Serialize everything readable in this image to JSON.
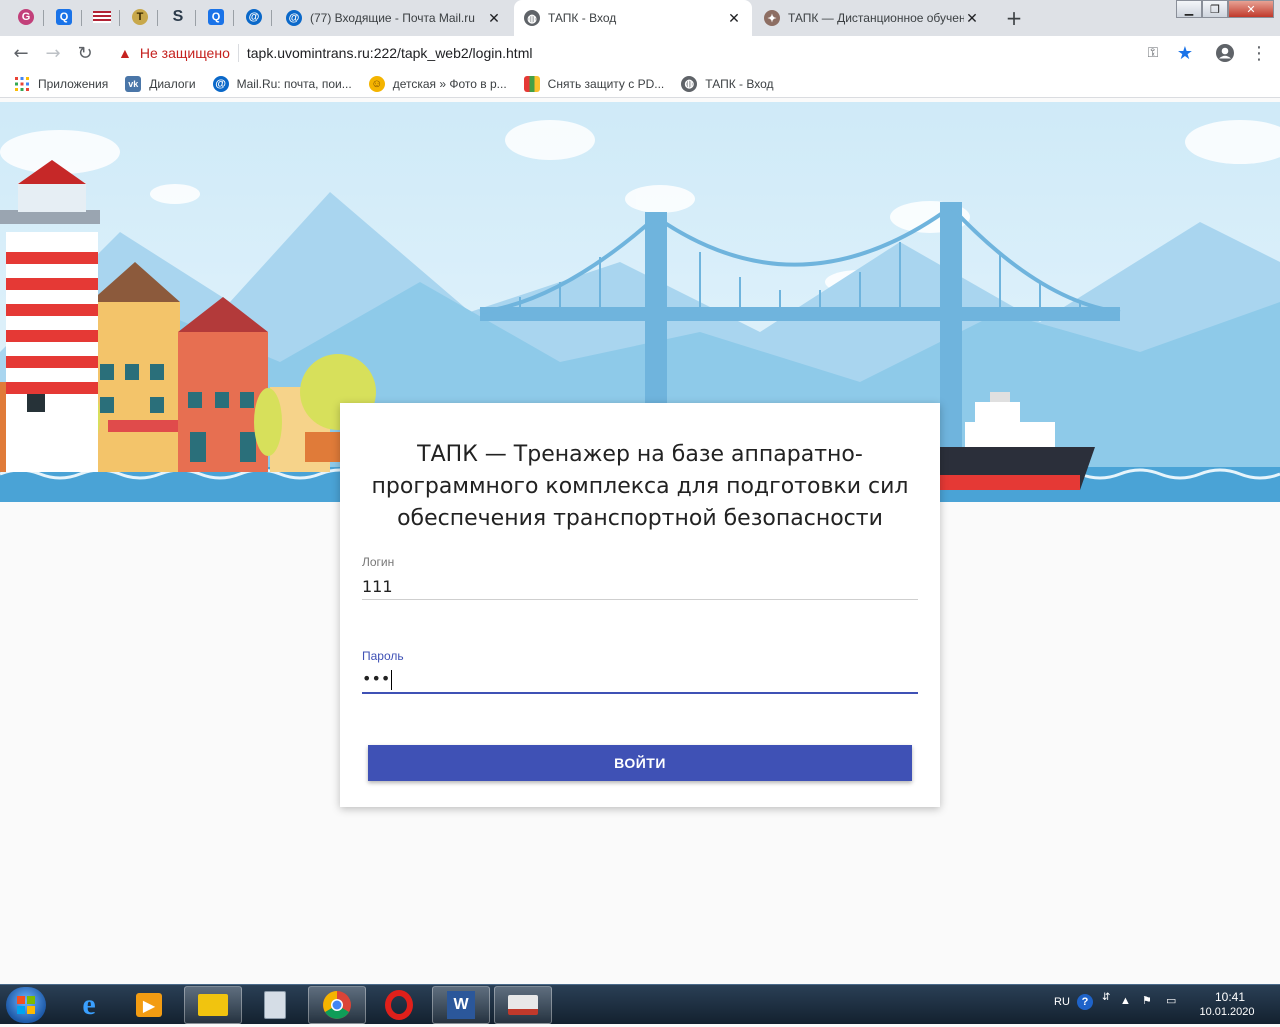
{
  "browser": {
    "pinned_tabs": [
      {
        "icon": "google-g-icon",
        "glyph": "G",
        "color": "#c2407a"
      },
      {
        "icon": "search-q-icon",
        "glyph": "Q",
        "color": "#1a73e8"
      },
      {
        "icon": "us-flag-icon",
        "glyph": "",
        "color": "#b22234"
      },
      {
        "icon": "coin-t-icon",
        "glyph": "T",
        "color": "#c8a84b"
      },
      {
        "icon": "skype-s-icon",
        "glyph": "S",
        "color": "#2b3a4a"
      },
      {
        "icon": "search-q-icon",
        "glyph": "Q",
        "color": "#1a73e8"
      },
      {
        "icon": "mail-at-icon",
        "glyph": "@",
        "color": "#0a68c9"
      }
    ],
    "tabs": [
      {
        "title": "(77) Входящие - Почта Mail.ru",
        "icon": "mail-at-icon",
        "active": false
      },
      {
        "title": "ТАПК - Вход",
        "icon": "globe-icon",
        "active": true
      },
      {
        "title": "ТАПК — Дистанционное обучение",
        "icon": "emblem-icon",
        "active": false
      }
    ],
    "close_glyph": "✕",
    "new_tab_glyph": "+",
    "security_label": "Не защищено",
    "url": "tapk.uvomintrans.ru:222/tapk_web2/login.html",
    "bookmarks": [
      {
        "label": "Приложения",
        "icon": "apps-grid-icon",
        "color": "#4285f4"
      },
      {
        "label": "Диалоги",
        "icon": "vk-icon",
        "color": "#4a76a8"
      },
      {
        "label": "Mail.Ru: почта, пои...",
        "icon": "mail-at-icon",
        "color": "#0a68c9"
      },
      {
        "label": "детская » Фото в р...",
        "icon": "smiley-icon",
        "color": "#f4b400"
      },
      {
        "label": "Снять защиту с PD...",
        "icon": "color-squares-icon",
        "color": "#e53935"
      },
      {
        "label": "ТАПК - Вход",
        "icon": "globe-icon",
        "color": "#5f6368"
      }
    ]
  },
  "login": {
    "title": "ТАПК — Тренажер на базе аппаратно-программного комплекса для подготовки сил обеспечения транспортной безопасности",
    "title_lines": [
      "ТАПК — Тренажер на базе аппаратно-",
      "программного комплекса для подготовки сил",
      "обеспечения транспортной безопасности"
    ],
    "login_label": "Логин",
    "login_value": "111",
    "password_label": "Пароль",
    "password_value": "•••",
    "submit_label": "ВОЙТИ",
    "accent_color": "#3f51b5"
  },
  "taskbar": {
    "apps": [
      "internet-explorer-icon",
      "media-player-icon",
      "file-explorer-icon",
      "calculator-icon",
      "chrome-icon",
      "opera-icon",
      "word-icon",
      "mail-client-icon"
    ],
    "language": "RU",
    "time": "10:41",
    "date": "10.01.2020"
  }
}
